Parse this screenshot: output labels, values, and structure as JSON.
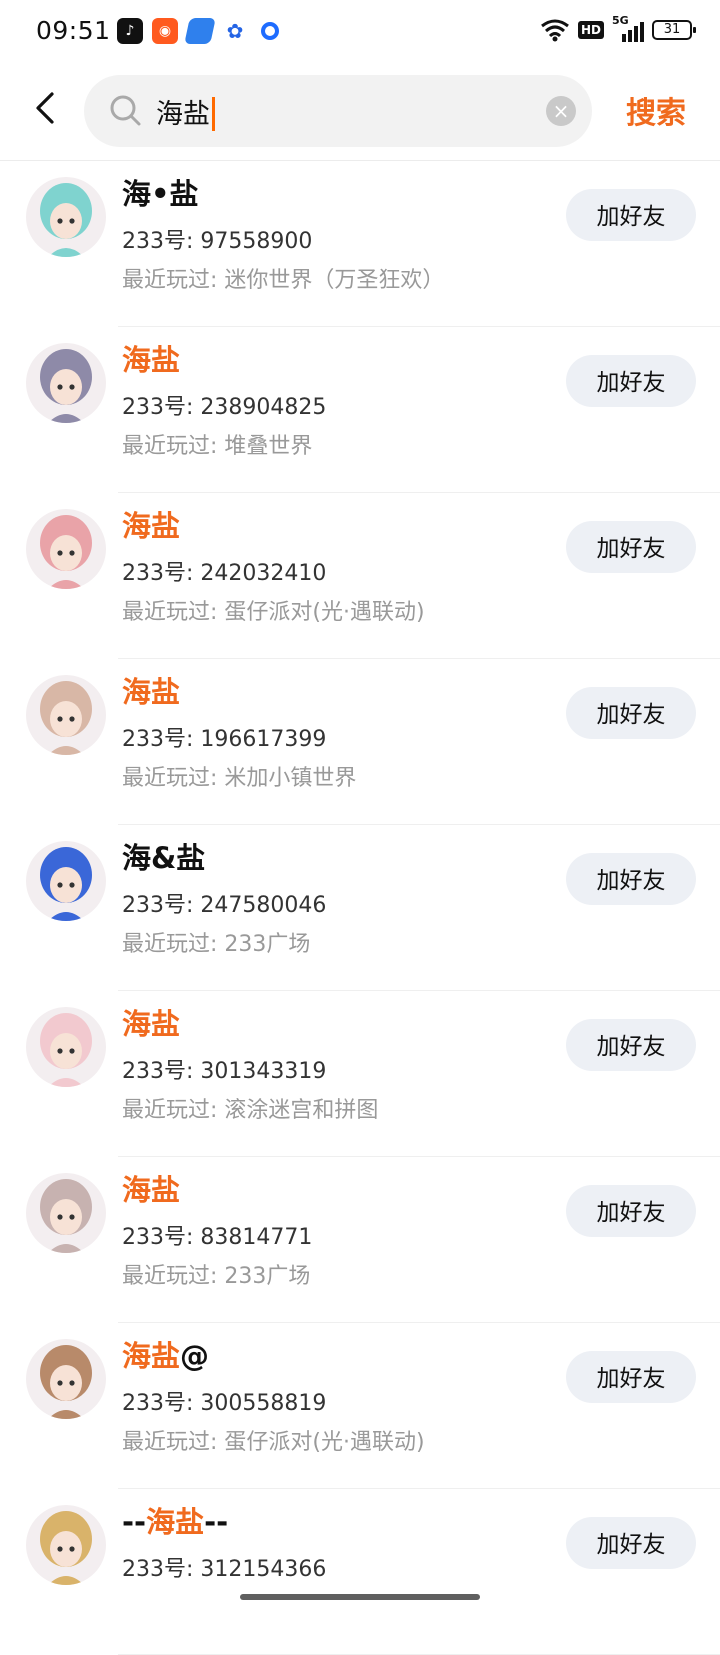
{
  "status_bar": {
    "time": "09:51",
    "network": "5G",
    "hd": "HD",
    "battery": "31"
  },
  "search": {
    "query": "海盐",
    "submit_label": "搜索"
  },
  "results": [
    {
      "nick_pre": "",
      "nick_hl": "",
      "nick_plain": "海•盐",
      "nick_post": "",
      "uid": "233号: 97558900",
      "played": "最近玩过: 迷你世界（万圣狂欢）",
      "button": "加好友"
    },
    {
      "nick_pre": "",
      "nick_hl": "海盐",
      "nick_plain": "",
      "nick_post": "",
      "uid": "233号: 238904825",
      "played": "最近玩过: 堆叠世界",
      "button": "加好友"
    },
    {
      "nick_pre": "",
      "nick_hl": "海盐",
      "nick_plain": "",
      "nick_post": "",
      "uid": "233号: 242032410",
      "played": "最近玩过: 蛋仔派对(光·遇联动)",
      "button": "加好友"
    },
    {
      "nick_pre": "",
      "nick_hl": "海盐",
      "nick_plain": "",
      "nick_post": "",
      "uid": "233号: 196617399",
      "played": "最近玩过: 米加小镇世界",
      "button": "加好友"
    },
    {
      "nick_pre": "",
      "nick_hl": "",
      "nick_plain": "海&盐",
      "nick_post": "",
      "uid": "233号: 247580046",
      "played": "最近玩过: 233广场",
      "button": "加好友"
    },
    {
      "nick_pre": "",
      "nick_hl": "海盐",
      "nick_plain": "",
      "nick_post": "",
      "uid": "233号: 301343319",
      "played": "最近玩过: 滚涂迷宫和拼图",
      "button": "加好友"
    },
    {
      "nick_pre": "",
      "nick_hl": "海盐",
      "nick_plain": "",
      "nick_post": "",
      "uid": "233号: 83814771",
      "played": "最近玩过: 233广场",
      "button": "加好友"
    },
    {
      "nick_pre": "",
      "nick_hl": "海盐",
      "nick_plain": "",
      "nick_post": "@",
      "uid": "233号: 300558819",
      "played": "最近玩过: 蛋仔派对(光·遇联动)",
      "button": "加好友"
    },
    {
      "nick_pre": "--",
      "nick_hl": "海盐",
      "nick_plain": "",
      "nick_post": "--",
      "uid": "233号: 312154366",
      "played": "",
      "button": "加好友"
    }
  ],
  "colors": {
    "accent": "#f06a1e",
    "button_bg": "#edf0f5",
    "avatar_palette": [
      "#7fd3cf",
      "#8e8aa8",
      "#e9a3a8",
      "#d8b7a6",
      "#3a67d8",
      "#f2c9cf",
      "#c7b2b0",
      "#b88a6a",
      "#d9b36a"
    ]
  }
}
